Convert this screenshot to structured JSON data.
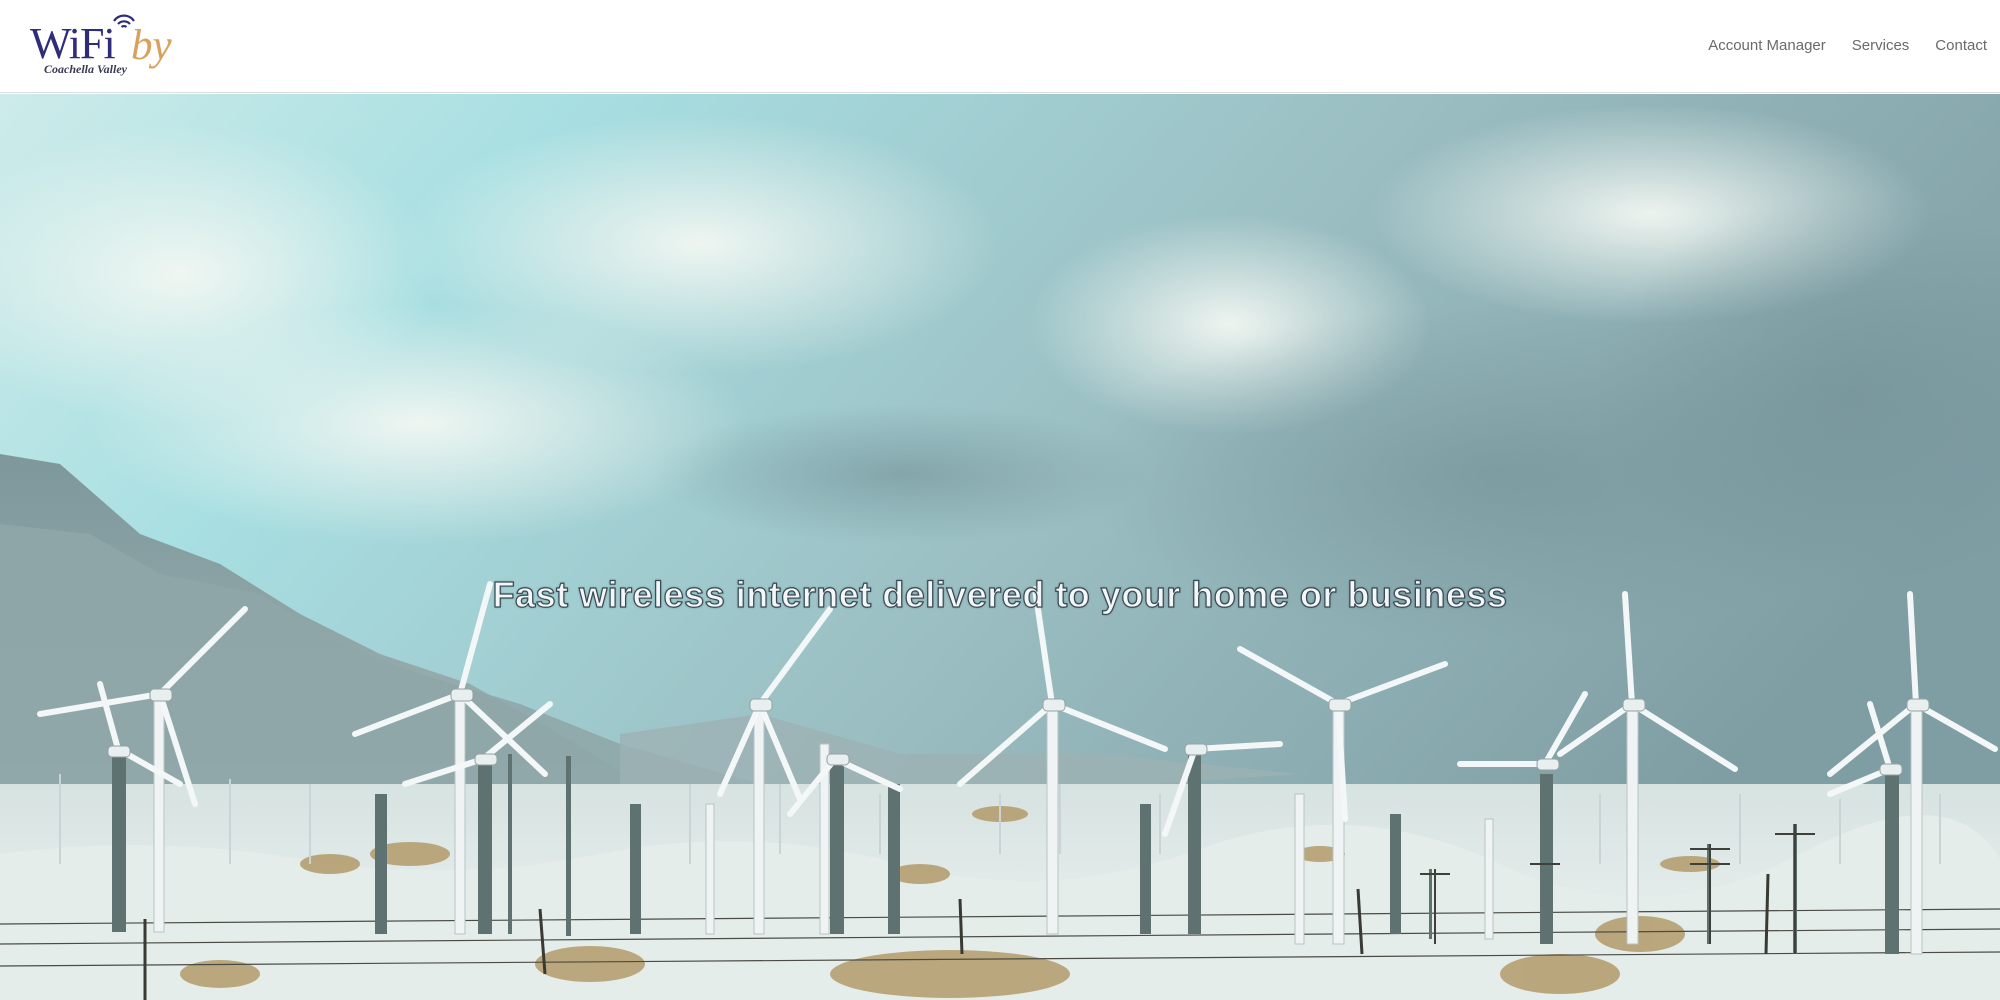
{
  "header": {
    "logo": {
      "wordmark": "WiFi",
      "suffix": "by",
      "tagline": "Coachella Valley"
    },
    "nav": [
      {
        "label": "Account Manager"
      },
      {
        "label": "Services"
      },
      {
        "label": "Contact"
      }
    ]
  },
  "hero": {
    "headline": "Fast wireless internet delivered to your home or business"
  },
  "colors": {
    "logo_primary": "#2f2d7a",
    "logo_accent": "#d8a15c",
    "nav_text": "#6a6a6a",
    "headline_text": "#f4f7f8"
  }
}
